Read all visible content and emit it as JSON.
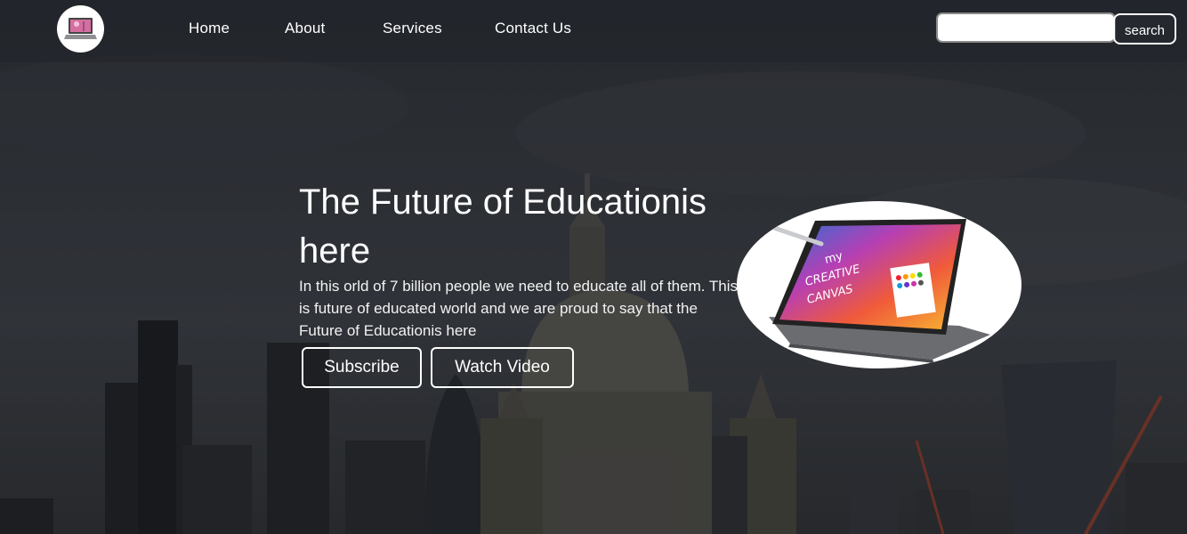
{
  "nav": {
    "logo_icon": "laptop-logo-icon",
    "links": [
      {
        "label": "Home"
      },
      {
        "label": "About"
      },
      {
        "label": "Services"
      },
      {
        "label": "Contact Us"
      }
    ],
    "search": {
      "value": "",
      "placeholder": "",
      "button_label": "search"
    }
  },
  "hero": {
    "title": "The Future of Educationis here",
    "text": "In this orld of 7 billion people we need to educate all of them. This is future of educated world and we are proud to say that the Future of Educationis here",
    "buttons": {
      "subscribe": "Subscribe",
      "watch": "Watch Video"
    },
    "image_icon": "convertible-laptop-image",
    "image_text": "my CREATIVE CANVAS"
  },
  "background": {
    "icon": "city-skyline-background"
  }
}
